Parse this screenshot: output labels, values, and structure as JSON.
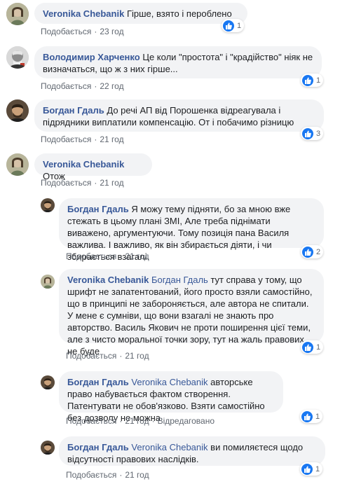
{
  "actions": {
    "like_label": "Подобається",
    "edited_label": "Відредаговано"
  },
  "comments": [
    {
      "author": "Veronika Chebanik",
      "mention": "",
      "text": "Гірше, взято і пероблено",
      "time": "23 год",
      "reactions": "1"
    },
    {
      "author": "Володимир Харченко",
      "mention": "",
      "text": "Це коли \"простота\" і \"крадійство\" ніяк не визначаться, що ж з них гірше...",
      "time": "22 год",
      "reactions": "1"
    },
    {
      "author": "Богдан Гдаль",
      "mention": "",
      "text": "До речі АП від Порошенка відреагувала і підрядники виплатили компенсацію. От і побачимо різницю",
      "time": "21 год",
      "reactions": "3"
    },
    {
      "author": "Veronika Chebanik",
      "mention": "",
      "text": "Отож",
      "time": "21 год",
      "reactions": ""
    },
    {
      "author": "Богдан Гдаль",
      "mention": "",
      "text": "Я можу тему підняти, бо за мною вже стежать в цьому плані ЗМІ, Але треба піднімати виважено, аргументуючи. Тому позиція пана Василя важлива. І важливо, як він збирається діяти, і чи збирається взагалі.",
      "time": "21 год",
      "reactions": "2"
    },
    {
      "author": "Veronika Chebanik",
      "mention": "Богдан Гдаль",
      "text": "тут справа у тому, що шрифт не запатентований, його просто взяли самостійно, що в принципі не забороняється, але автора не спитали. У мене є сумніви, що вони взагалі не знають про авторство. Василь Якович не проти поширення цієї теми, але з чисто моральної точки зору, тут на жаль правових не буде",
      "time": "21 год",
      "reactions": "1"
    },
    {
      "author": "Богдан Гдаль",
      "mention": "Veronika Chebanik",
      "text": "авторське право набувається фактом створення. Патентувати не обов'язково. Взяти самостійно без дозволу не можна",
      "time": "21 год",
      "reactions": "1",
      "edited": true
    },
    {
      "author": "Богдан Гдаль",
      "mention": "Veronika Chebanik",
      "text": "ви помиляєтеся щодо відсутності правових наслідків.",
      "time": "21 год",
      "reactions": "1"
    }
  ]
}
